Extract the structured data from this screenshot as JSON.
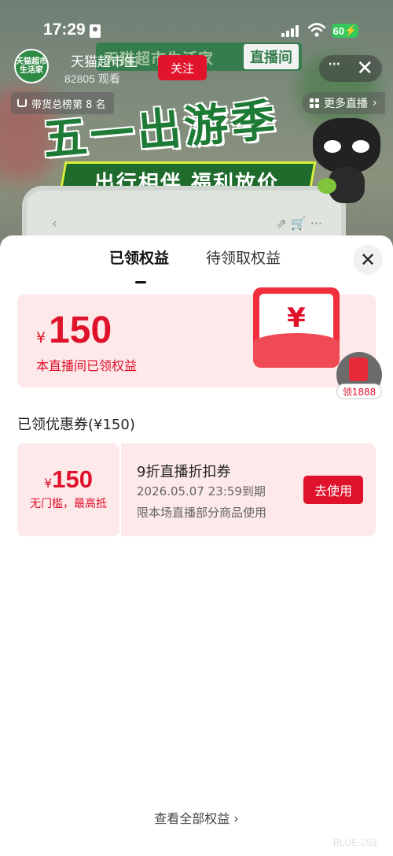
{
  "status_bar": {
    "time": "17:29",
    "battery": "60"
  },
  "stream": {
    "channel_banner": "天猫超市生活家",
    "channel_tag": "直播间",
    "promo_title": "五一出游季",
    "promo_subtitle": "出行相伴 福利放价",
    "anchor_avatar_text": "天猫超市\n生活家",
    "anchor_name": "天猫超市生",
    "views": "82805 观看",
    "follow_label": "关注",
    "rank_text": "带货总榜第 8 名",
    "more_live_label": "更多直播"
  },
  "sheet": {
    "tabs": [
      {
        "label": "已领权益"
      },
      {
        "label": "待领取权益"
      }
    ],
    "summary": {
      "currency": "¥",
      "amount": "150",
      "desc": "本直播间已领权益"
    },
    "envelope_symbol": "¥",
    "float_gift_label": "领1888",
    "section_title": "已领优惠券(¥150)",
    "coupon": {
      "currency": "¥",
      "amount": "150",
      "condition": "无门槛，最高抵",
      "name": "9折直播折扣券",
      "expiry": "2026.05.07 23:59到期",
      "scope": "限本场直播部分商品使用",
      "use_label": "去使用"
    },
    "view_all": "查看全部权益 ›",
    "watermark": "BLUE-253"
  },
  "colors": {
    "accent_red": "#e0112b",
    "coupon_bg": "#fde9e9",
    "battery_green": "#34c759"
  }
}
